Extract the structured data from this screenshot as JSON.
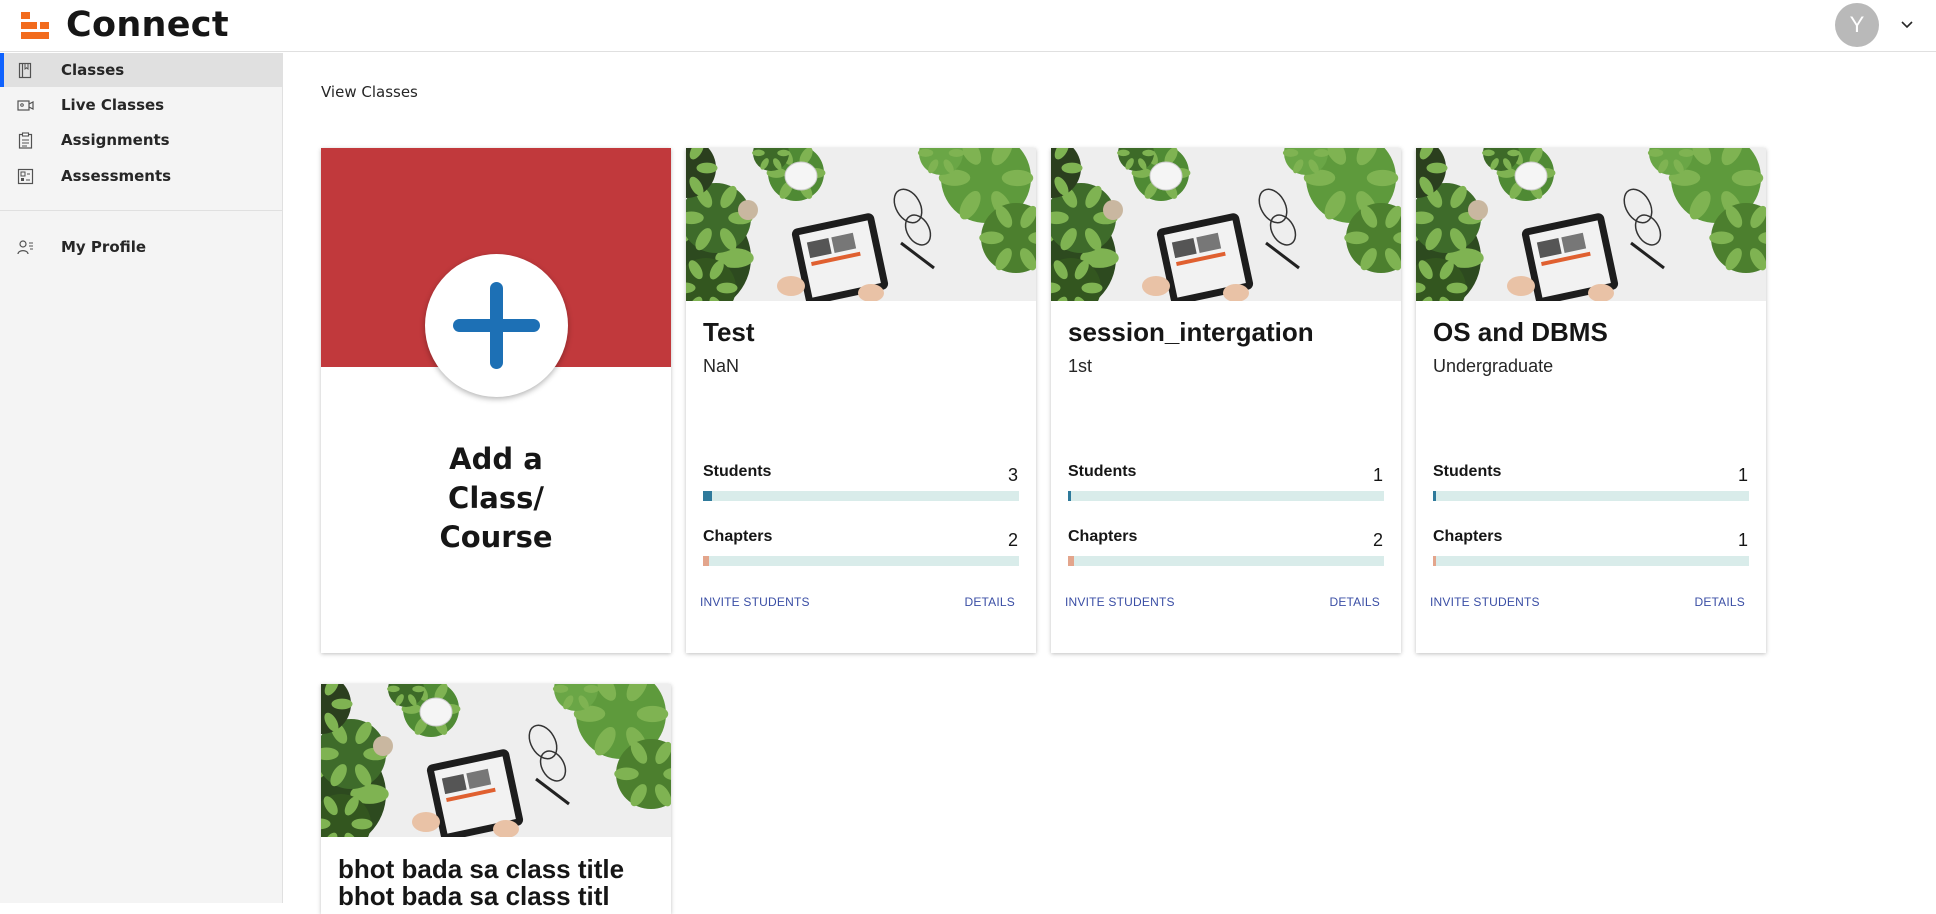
{
  "header": {
    "app_title": "Connect",
    "avatar_initial": "Y"
  },
  "sidebar": {
    "items": [
      {
        "label": "Classes",
        "icon": "book-icon"
      },
      {
        "label": "Live Classes",
        "icon": "video-icon"
      },
      {
        "label": "Assignments",
        "icon": "clipboard-icon"
      },
      {
        "label": "Assessments",
        "icon": "assessment-icon"
      },
      {
        "label": "My Profile",
        "icon": "user-list-icon"
      }
    ]
  },
  "main": {
    "heading": "View Classes",
    "add_card": {
      "line1": "Add a",
      "line2": "Class/",
      "line3": "Course"
    },
    "classes": [
      {
        "title": "Test",
        "subtitle": "NaN",
        "students_label": "Students",
        "students": "3",
        "students_fill": 0.03,
        "chapters_label": "Chapters",
        "chapters": "2",
        "chapters_fill": 0.02,
        "invite": "INVITE STUDENTS",
        "details": "DETAILS"
      },
      {
        "title": "session_intergation",
        "subtitle": "1st",
        "students_label": "Students",
        "students": "1",
        "students_fill": 0.01,
        "chapters_label": "Chapters",
        "chapters": "2",
        "chapters_fill": 0.02,
        "invite": "INVITE STUDENTS",
        "details": "DETAILS"
      },
      {
        "title": "OS and DBMS",
        "subtitle": "Undergraduate",
        "students_label": "Students",
        "students": "1",
        "students_fill": 0.01,
        "chapters_label": "Chapters",
        "chapters": "1",
        "chapters_fill": 0.01,
        "invite": "INVITE STUDENTS",
        "details": "DETAILS"
      },
      {
        "title": "bhot bada sa class title bhot bada sa class titl"
      }
    ]
  },
  "colors": {
    "accent": "#0f62fe",
    "add_card": "#c1393c",
    "plus": "#1d70b5",
    "student_bar": "#2f7a9b",
    "chapter_bar": "#e3a58c",
    "bar_track": "#d9ecea",
    "link": "#3a4ea5"
  }
}
